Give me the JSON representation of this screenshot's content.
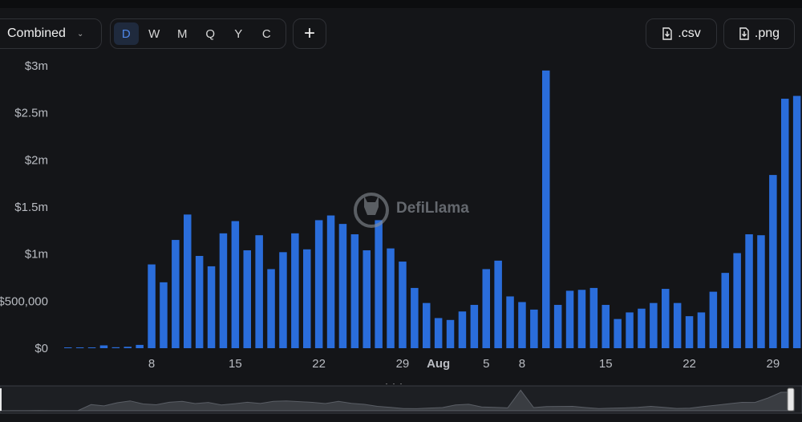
{
  "toolbar": {
    "combined_label": "Combined",
    "ranges": [
      "D",
      "W",
      "M",
      "Q",
      "Y",
      "C"
    ],
    "active_range": "D",
    "add_label": "+",
    "csv_label": ".csv",
    "png_label": ".png"
  },
  "watermark": {
    "text": "DefiLlama"
  },
  "colors": {
    "bar": "#2a6ddb",
    "background": "#141518",
    "axis_text": "#b9bcc2"
  },
  "chart_data": {
    "type": "bar",
    "yticks": [
      "$0",
      "$500,000",
      "$1m",
      "$1.5m",
      "$2m",
      "$2.5m",
      "$3m"
    ],
    "ytick_values": [
      0,
      500000,
      1000000,
      1500000,
      2000000,
      2500000,
      3000000
    ],
    "ylim": [
      0,
      3000000
    ],
    "xticks": [
      {
        "day": 8,
        "label": "8"
      },
      {
        "day": 15,
        "label": "15"
      },
      {
        "day": 22,
        "label": "22"
      },
      {
        "day": 29,
        "label": "29"
      },
      {
        "day": 32,
        "label": "Aug"
      },
      {
        "day": 36,
        "label": "5"
      },
      {
        "day": 39,
        "label": "8"
      },
      {
        "day": 46,
        "label": "15"
      },
      {
        "day": 53,
        "label": "22"
      },
      {
        "day": 60,
        "label": "29"
      }
    ],
    "values": [
      5000,
      8000,
      7000,
      30000,
      10000,
      15000,
      35000,
      890000,
      700000,
      1150000,
      1420000,
      980000,
      870000,
      1220000,
      1350000,
      1040000,
      1200000,
      840000,
      1020000,
      1220000,
      1050000,
      1360000,
      1410000,
      1320000,
      1210000,
      1040000,
      1360000,
      1060000,
      920000,
      640000,
      480000,
      320000,
      300000,
      390000,
      460000,
      840000,
      930000,
      550000,
      490000,
      410000,
      2950000,
      460000,
      610000,
      620000,
      640000,
      460000,
      310000,
      380000,
      420000,
      480000,
      630000,
      480000,
      340000,
      380000,
      600000,
      800000,
      1010000,
      1210000,
      1200000,
      1840000,
      2650000,
      2680000
    ]
  }
}
